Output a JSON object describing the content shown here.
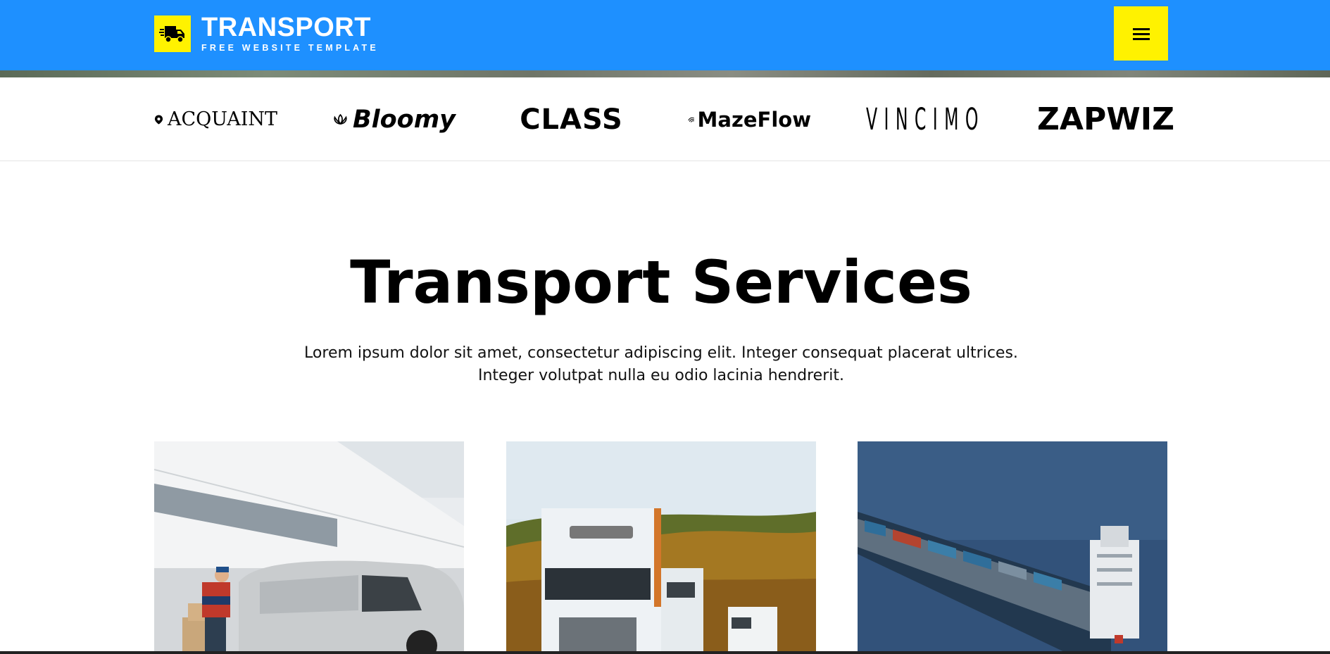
{
  "header": {
    "logo_title": "TRANSPORT",
    "logo_subtitle": "FREE WEBSITE TEMPLATE",
    "logo_icon": "truck-icon",
    "menu_icon": "hamburger-icon",
    "colors": {
      "header_bg": "#1e90ff",
      "accent": "#fff200"
    }
  },
  "brands": [
    {
      "name": "ACQUAINT"
    },
    {
      "name": "Bloomy"
    },
    {
      "name": "CLASS"
    },
    {
      "name": "MazeFlow"
    },
    {
      "name": "VINCIMO"
    },
    {
      "name": "ZAPWIZ"
    }
  ],
  "services": {
    "title": "Transport Services",
    "description_line1": "Lorem ipsum dolor sit amet, consectetur adipiscing elit. Integer consequat placerat ultrices.",
    "description_line2": "Integer volutpat nulla eu odio lacinia hendrerit.",
    "cards": [
      {
        "image": "delivery-van-photo"
      },
      {
        "image": "trucks-photo"
      },
      {
        "image": "cargo-ship-photo"
      }
    ]
  }
}
